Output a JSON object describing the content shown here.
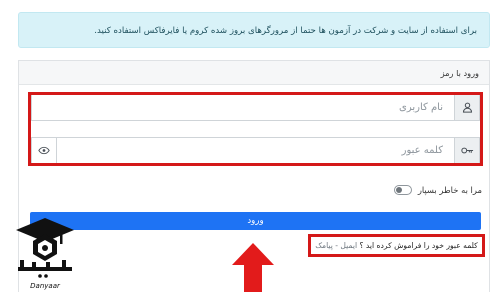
{
  "notice": {
    "text": "برای استفاده از سایت و شرکت در آزمون ها حتما از مرورگرهای بروز شده کروم یا فایرفاکس استفاده کنید."
  },
  "card": {
    "title": "ورود با رمز"
  },
  "username": {
    "placeholder": "نام کاربری",
    "icon": "user-icon"
  },
  "password": {
    "placeholder": "کلمه عبور",
    "icon": "key-icon",
    "toggle_icon": "eye-icon"
  },
  "remember": {
    "label": "مرا به خاطر بسپار",
    "checked": false
  },
  "login": {
    "label": "ورود"
  },
  "forgot": {
    "question": "کلمه عبور خود را فراموش کرده اید ؟",
    "email_link": "ایمیل",
    "separator": "-",
    "sms_link": "پیامک"
  },
  "logo": {
    "name": "دانیار",
    "sub": "Danyaar"
  },
  "colors": {
    "notice_bg": "#d8f2f8",
    "highlight_red": "#d41818",
    "primary_blue": "#1e73f4",
    "arrow_red": "#e21b1b"
  }
}
